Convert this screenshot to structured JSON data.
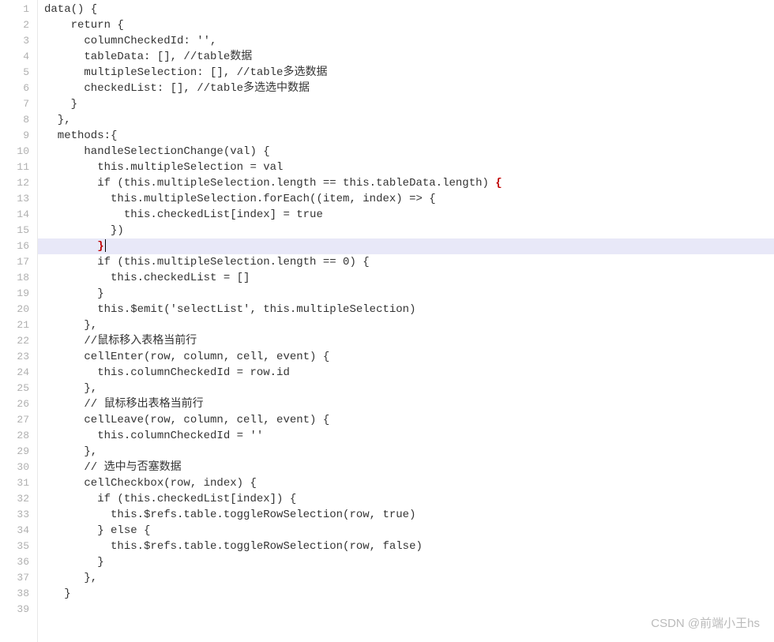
{
  "editor": {
    "highlighted_line": 16,
    "lines": [
      {
        "num": "1",
        "text": "data() {"
      },
      {
        "num": "2",
        "text": "    return {"
      },
      {
        "num": "3",
        "text": "      columnCheckedId: '',"
      },
      {
        "num": "4",
        "text": "      tableData: [], //table数据"
      },
      {
        "num": "5",
        "text": "      multipleSelection: [], //table多选数据"
      },
      {
        "num": "6",
        "text": "      checkedList: [], //table多选选中数据"
      },
      {
        "num": "7",
        "text": "    }"
      },
      {
        "num": "8",
        "text": "  },"
      },
      {
        "num": "9",
        "text": "  methods:{"
      },
      {
        "num": "10",
        "text": "      handleSelectionChange(val) {"
      },
      {
        "num": "11",
        "text": "        this.multipleSelection = val"
      },
      {
        "num": "12",
        "text": "        if (this.multipleSelection.length == this.tableData.length) ",
        "end_brace_red": "{"
      },
      {
        "num": "13",
        "text": "          this.multipleSelection.forEach((item, index) => {"
      },
      {
        "num": "14",
        "text": "            this.checkedList[index] = true"
      },
      {
        "num": "15",
        "text": "          })"
      },
      {
        "num": "16",
        "text": "        ",
        "end_brace_red": "}",
        "cursor": true
      },
      {
        "num": "17",
        "text": "        if (this.multipleSelection.length == 0) {"
      },
      {
        "num": "18",
        "text": "          this.checkedList = []"
      },
      {
        "num": "19",
        "text": "        }"
      },
      {
        "num": "20",
        "text": "        this.$emit('selectList', this.multipleSelection)"
      },
      {
        "num": "21",
        "text": "      },"
      },
      {
        "num": "22",
        "text": "      //鼠标移入表格当前行"
      },
      {
        "num": "23",
        "text": "      cellEnter(row, column, cell, event) {"
      },
      {
        "num": "24",
        "text": "        this.columnCheckedId = row.id"
      },
      {
        "num": "25",
        "text": "      },"
      },
      {
        "num": "26",
        "text": "      // 鼠标移出表格当前行"
      },
      {
        "num": "27",
        "text": "      cellLeave(row, column, cell, event) {"
      },
      {
        "num": "28",
        "text": "        this.columnCheckedId = ''"
      },
      {
        "num": "29",
        "text": "      },"
      },
      {
        "num": "30",
        "text": "      // 选中与否塞数据"
      },
      {
        "num": "31",
        "text": "      cellCheckbox(row, index) {"
      },
      {
        "num": "32",
        "text": "        if (this.checkedList[index]) {"
      },
      {
        "num": "33",
        "text": "          this.$refs.table.toggleRowSelection(row, true)"
      },
      {
        "num": "34",
        "text": "        } else {"
      },
      {
        "num": "35",
        "text": "          this.$refs.table.toggleRowSelection(row, false)"
      },
      {
        "num": "36",
        "text": "        }"
      },
      {
        "num": "37",
        "text": "      },"
      },
      {
        "num": "38",
        "text": "   }"
      },
      {
        "num": "39",
        "text": ""
      }
    ]
  },
  "watermark": "CSDN @前端小王hs"
}
